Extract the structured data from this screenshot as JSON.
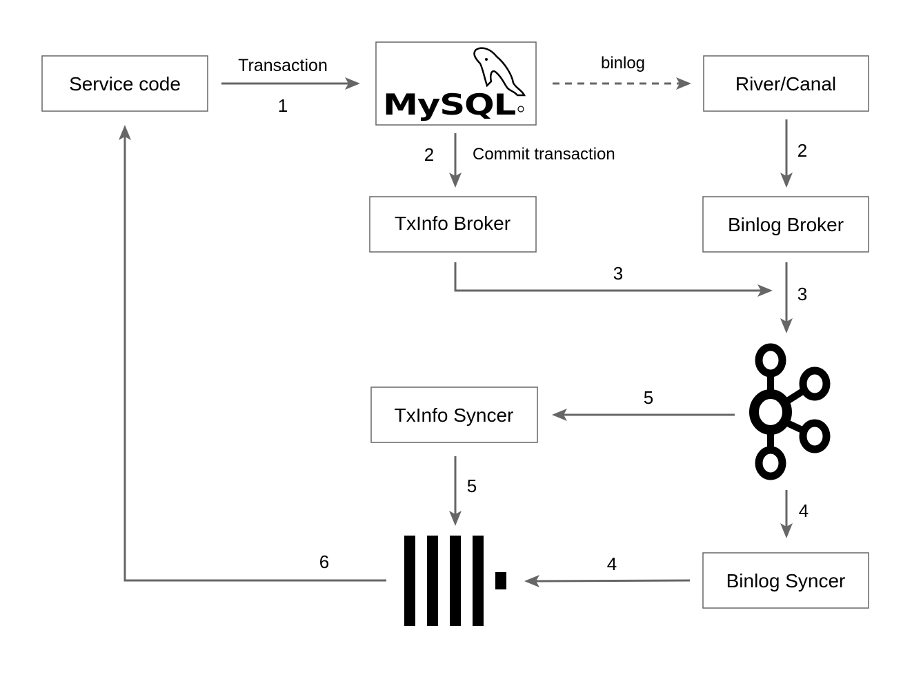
{
  "nodes": {
    "service_code": "Service code",
    "mysql_logo": "MySQL",
    "river_canal": "River/Canal",
    "txinfo_broker": "TxInfo Broker",
    "binlog_broker": "Binlog Broker",
    "txinfo_syncer": "TxInfo Syncer",
    "binlog_syncer": "Binlog Syncer",
    "kafka_icon": "kafka-icon",
    "clickhouse_icon": "clickhouse-icon"
  },
  "edges": {
    "transaction_label": "Transaction",
    "transaction_step": "1",
    "binlog_label": "binlog",
    "commit_label": "Commit transaction",
    "commit_step": "2",
    "river_to_broker_step": "2",
    "txinfo_to_kafka_step": "3",
    "binlog_broker_to_kafka_step": "3",
    "kafka_to_txinfo_syncer_step": "5",
    "txinfo_syncer_to_ch_step": "5",
    "kafka_to_binlog_syncer_step": "4",
    "binlog_syncer_to_ch_step": "4",
    "ch_to_service_step": "6"
  },
  "colors": {
    "arrow": "#666666",
    "border": "#666666",
    "icon": "#000000"
  }
}
